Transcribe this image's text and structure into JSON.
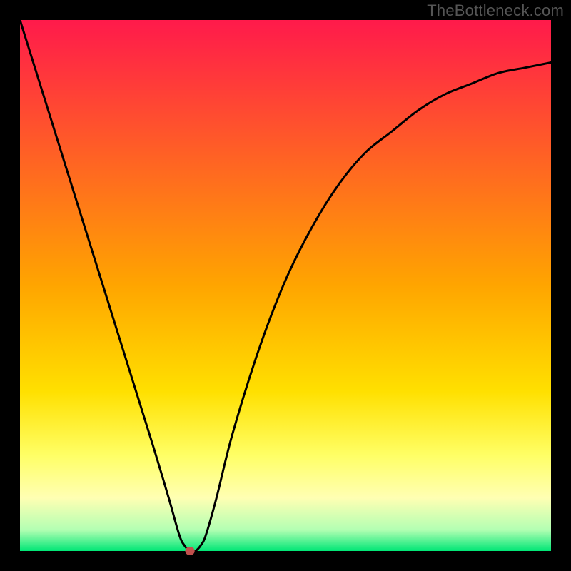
{
  "watermark": "TheBottleneck.com",
  "chart_data": {
    "type": "line",
    "title": "",
    "xlabel": "",
    "ylabel": "",
    "xlim": [
      0,
      100
    ],
    "ylim": [
      0,
      100
    ],
    "grid": false,
    "legend": false,
    "background_gradient": [
      {
        "pos": 0,
        "color": "#ff1a4b"
      },
      {
        "pos": 50,
        "color": "#ffa500"
      },
      {
        "pos": 70,
        "color": "#ffe000"
      },
      {
        "pos": 82,
        "color": "#ffff66"
      },
      {
        "pos": 90,
        "color": "#ffffb3"
      },
      {
        "pos": 96,
        "color": "#b3ffb3"
      },
      {
        "pos": 100,
        "color": "#00e676"
      }
    ],
    "series": [
      {
        "name": "curve",
        "color": "#000000",
        "x": [
          0,
          5,
          10,
          15,
          20,
          25,
          28,
          30,
          31,
          32,
          33,
          34,
          35,
          37,
          40,
          45,
          50,
          55,
          60,
          65,
          70,
          75,
          80,
          85,
          90,
          95,
          100
        ],
        "values": [
          100,
          84,
          68,
          52,
          36,
          20,
          10,
          3,
          1,
          0,
          0,
          1,
          3,
          10,
          22,
          38,
          51,
          61,
          69,
          75,
          79,
          83,
          86,
          88,
          90,
          91,
          92
        ]
      }
    ],
    "marker": {
      "x": 32,
      "y": 0,
      "color": "#c0504d",
      "radius": 6
    }
  },
  "frame": {
    "border_color": "#000000",
    "border_px": 28
  }
}
